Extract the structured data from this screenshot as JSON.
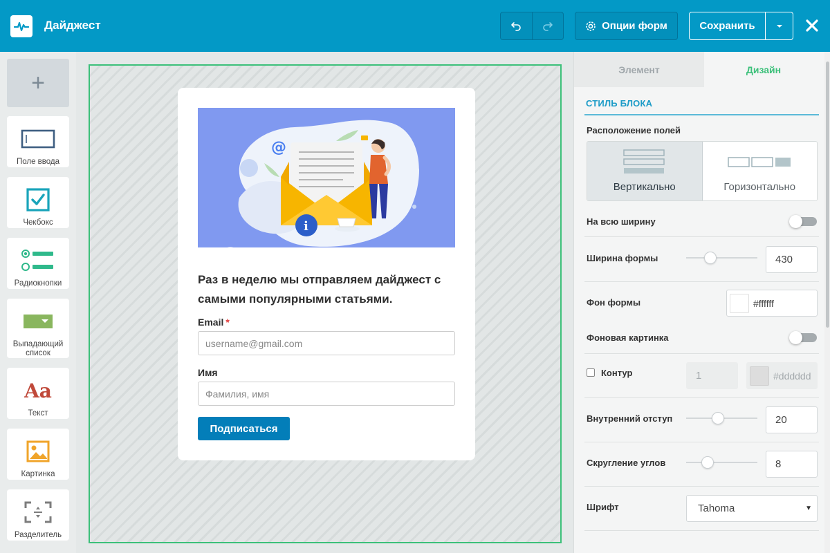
{
  "header": {
    "title": "Дайджест",
    "form_options_label": "Опции форм",
    "save_label": "Сохранить"
  },
  "palette": {
    "items": [
      {
        "label": "Поле ввода",
        "icon": "input-field-icon"
      },
      {
        "label": "Чекбокс",
        "icon": "checkbox-icon"
      },
      {
        "label": "Радиокнопки",
        "icon": "radio-buttons-icon"
      },
      {
        "label": "Выпадающий список",
        "icon": "dropdown-icon"
      },
      {
        "label": "Текст",
        "icon": "text-icon",
        "glyph": "Aa"
      },
      {
        "label": "Картинка",
        "icon": "image-icon"
      },
      {
        "label": "Разделитель",
        "icon": "divider-icon"
      }
    ]
  },
  "form": {
    "heading": "Раз в неделю мы отправляем дайджест с самыми популярными статьями.",
    "email_label": "Email",
    "required_mark": "*",
    "email_placeholder": "username@gmail.com",
    "name_label": "Имя",
    "name_placeholder": "Фамилия, имя",
    "submit_label": "Подписаться"
  },
  "panel": {
    "tabs": [
      "Элемент",
      "Дизайн"
    ],
    "active_tab": "Дизайн",
    "section_title": "СТИЛЬ БЛОКА",
    "fields_layout_label": "Расположение полей",
    "layout_vertical": "Вертикально",
    "layout_horizontal": "Горизонтально",
    "full_width_label": "На всю ширину",
    "full_width_on": false,
    "form_width_label": "Ширина формы",
    "form_width_value": "430",
    "form_bg_label": "Фон формы",
    "form_bg_value": "#ffffff",
    "bg_image_label": "Фоновая картинка",
    "bg_image_on": false,
    "border_label": "Контур",
    "border_width_value": "1",
    "border_color_value": "#dddddd",
    "padding_label": "Внутренний отступ",
    "padding_value": "20",
    "radius_label": "Скругление углов",
    "radius_value": "8",
    "font_label": "Шрифт",
    "font_value": "Tahoma"
  },
  "colors": {
    "header_bg": "#0399c6",
    "accent_green": "#3cc07a",
    "submit_button": "#037eb9",
    "section_title": "#1c9bc7"
  }
}
